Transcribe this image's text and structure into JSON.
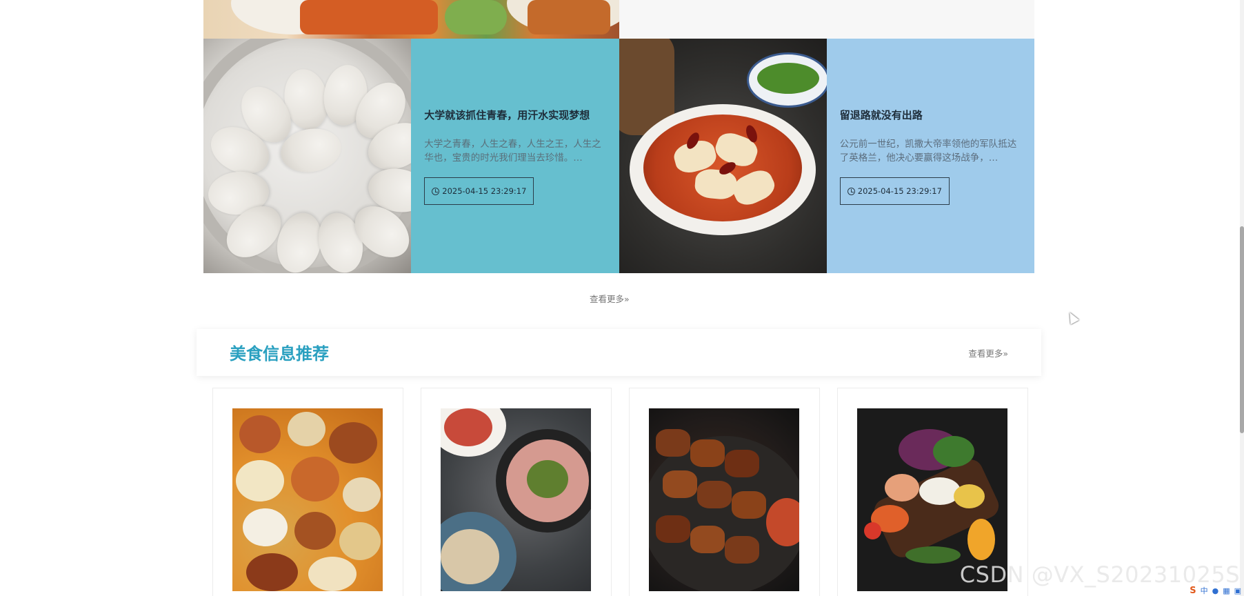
{
  "news": [
    {
      "title": "大学就该抓住青春，用汗水实现梦想",
      "desc": "大学之青春，人生之春，人生之王，人生之华也，宝贵的时光我们理当去珍惜。…",
      "time": "2025-04-15 23:29:17",
      "image_icon": "steamed-buns",
      "card_color": "#66bfcf"
    },
    {
      "title": "留退路就没有出路",
      "desc": "公元前一世纪，凯撒大帝率领他的军队抵达了英格兰，他决心要赢得这场战争，…",
      "time": "2025-04-15 23:29:17",
      "image_icon": "boiled-fish",
      "card_color": "#9fcbeb"
    }
  ],
  "news_more": "查看更多»",
  "food_section": {
    "title": "美食信息推荐",
    "more": "查看更多»",
    "title_color": "#2aa0c0",
    "items": [
      {
        "image_icon": "banquet-dishes"
      },
      {
        "image_icon": "plated-salad"
      },
      {
        "image_icon": "bbq-skewers"
      },
      {
        "image_icon": "cold-platter"
      }
    ]
  },
  "watermark": "CSDN @VX_S20231025S",
  "tray": {
    "ime": "S",
    "lang": "中"
  }
}
